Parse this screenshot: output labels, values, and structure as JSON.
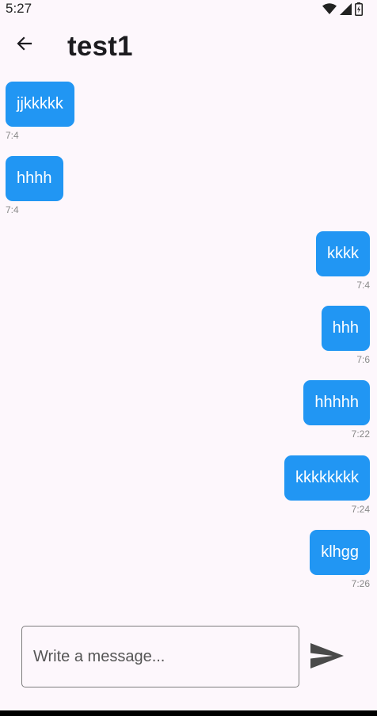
{
  "status_bar": {
    "time": "5:27",
    "icons": [
      "wifi-icon",
      "signal-icon",
      "battery-charging-icon"
    ]
  },
  "app_bar": {
    "back_icon": "arrow-left-icon",
    "title": "test1"
  },
  "messages": [
    {
      "direction": "received",
      "text": "jjkkkkk",
      "time": "7:4"
    },
    {
      "direction": "received",
      "text": "hhhh",
      "time": "7:4"
    },
    {
      "direction": "sent",
      "text": "kkkk",
      "time": "7:4"
    },
    {
      "direction": "sent",
      "text": "hhh",
      "time": "7:6"
    },
    {
      "direction": "sent",
      "text": "hhhhh",
      "time": "7:22"
    },
    {
      "direction": "sent",
      "text": "kkkkkkkk",
      "time": "7:24"
    },
    {
      "direction": "sent",
      "text": "klhgg",
      "time": "7:26"
    }
  ],
  "composer": {
    "placeholder": "Write a message...",
    "value": "",
    "send_icon": "send-icon"
  },
  "colors": {
    "bubble": "#2196f3",
    "bubble_text": "#ffffff",
    "background": "#fdf7fc",
    "timestamp": "#8a8a8a"
  }
}
